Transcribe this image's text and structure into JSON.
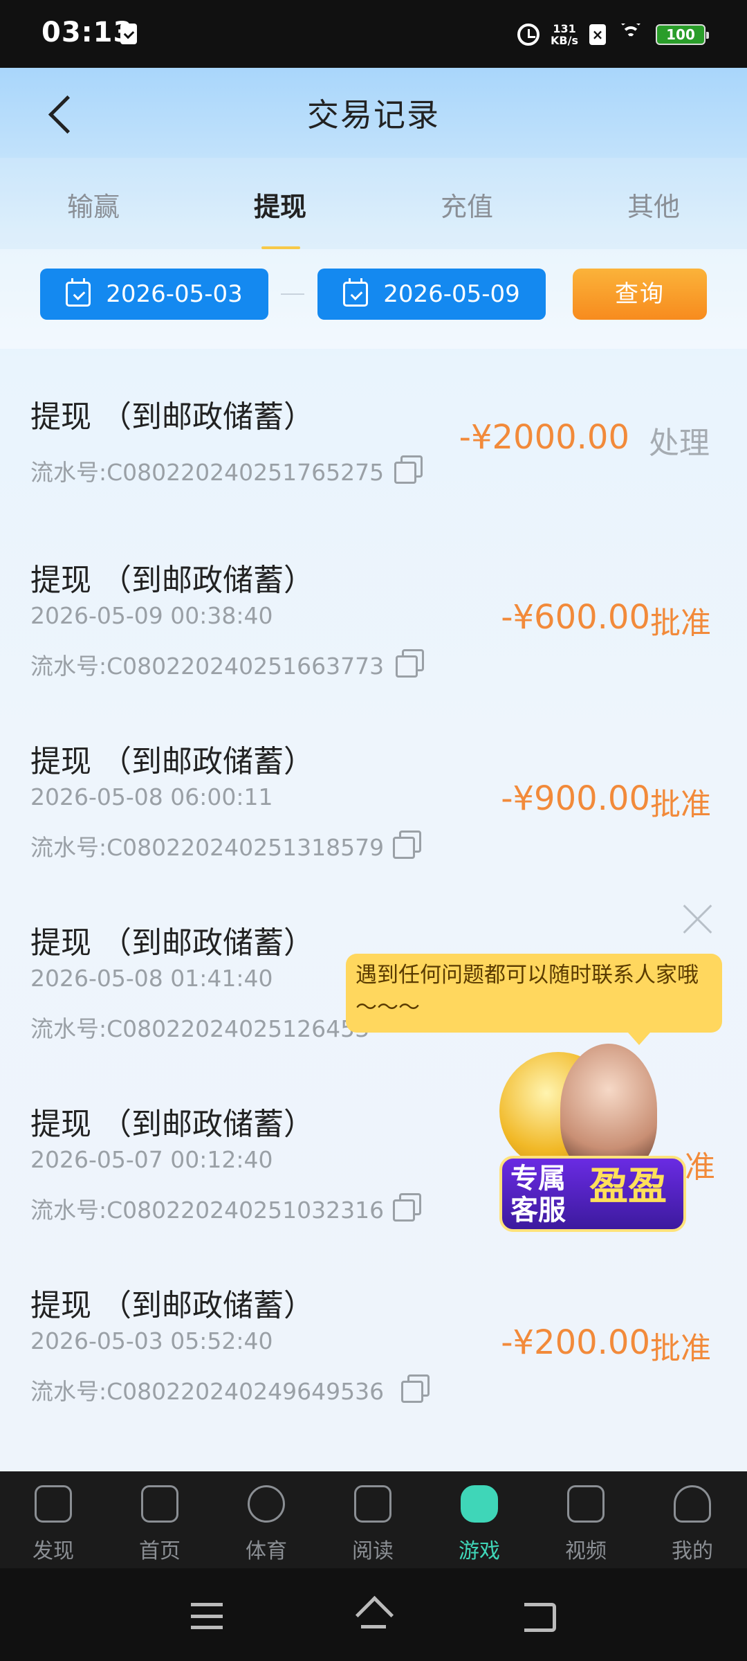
{
  "status_bar": {
    "time": "03:13",
    "net_speed_value": "131",
    "net_speed_unit": "KB/s",
    "battery": "100"
  },
  "header": {
    "title": "交易记录"
  },
  "tabs": [
    {
      "label": "输赢",
      "active": false
    },
    {
      "label": "提现",
      "active": true
    },
    {
      "label": "充值",
      "active": false
    },
    {
      "label": "其他",
      "active": false
    }
  ],
  "filter": {
    "start_date": "2026-05-03",
    "end_date": "2026-05-09",
    "query_label": "查询"
  },
  "records": [
    {
      "title": "提现 （到邮政储蓄）",
      "time": "",
      "serial": "流水号:C08022024025176527​5",
      "amount": "-¥2000.00",
      "status": "处理"
    },
    {
      "title": "提现 （到邮政储蓄）",
      "time": "2026-05-09 00:38:40",
      "serial": "流水号:C08022024025166377​3",
      "amount": "-¥600.00",
      "status": "批准"
    },
    {
      "title": "提现 （到邮政储蓄）",
      "time": "2026-05-08 06:00:11",
      "serial": "流水号:C08022024025131857​9",
      "amount": "-¥900.00",
      "status": "批准"
    },
    {
      "title": "提现 （到邮政储蓄）",
      "time": "2026-05-08 01:41:40",
      "serial": "流水号:C08022024025126453",
      "amount": "",
      "status": ""
    },
    {
      "title": "提现 （到邮政储蓄）",
      "time": "2026-05-07 00:12:40",
      "serial": "流水号:C08022024025103231​6",
      "amount": "",
      "status": "准"
    },
    {
      "title": "提现 （到邮政储蓄）",
      "time": "2026-05-03 05:52:40",
      "serial": "流水号:C08022024024964953​6",
      "amount": "-¥200.00",
      "status": "批准"
    }
  ],
  "support_popup": {
    "message": "遇到任何问题都可以随时联系人家哦～～～",
    "badge_line1": "专属",
    "badge_line2": "客服",
    "badge_name": "盈盈"
  },
  "bottom_nav": [
    {
      "label": "发现",
      "icon": "people-icon",
      "active": false
    },
    {
      "label": "首页",
      "icon": "home-icon",
      "active": false
    },
    {
      "label": "体育",
      "icon": "basketball-icon",
      "active": false
    },
    {
      "label": "阅读",
      "icon": "book-icon",
      "active": false
    },
    {
      "label": "游戏",
      "icon": "gamepad-icon",
      "active": true
    },
    {
      "label": "视频",
      "icon": "video-icon",
      "active": false
    },
    {
      "label": "我的",
      "icon": "user-icon",
      "active": false
    }
  ],
  "colors": {
    "accent_blue": "#1489f0",
    "accent_orange": "#f28a3a",
    "nav_active": "#3fd6b8"
  }
}
